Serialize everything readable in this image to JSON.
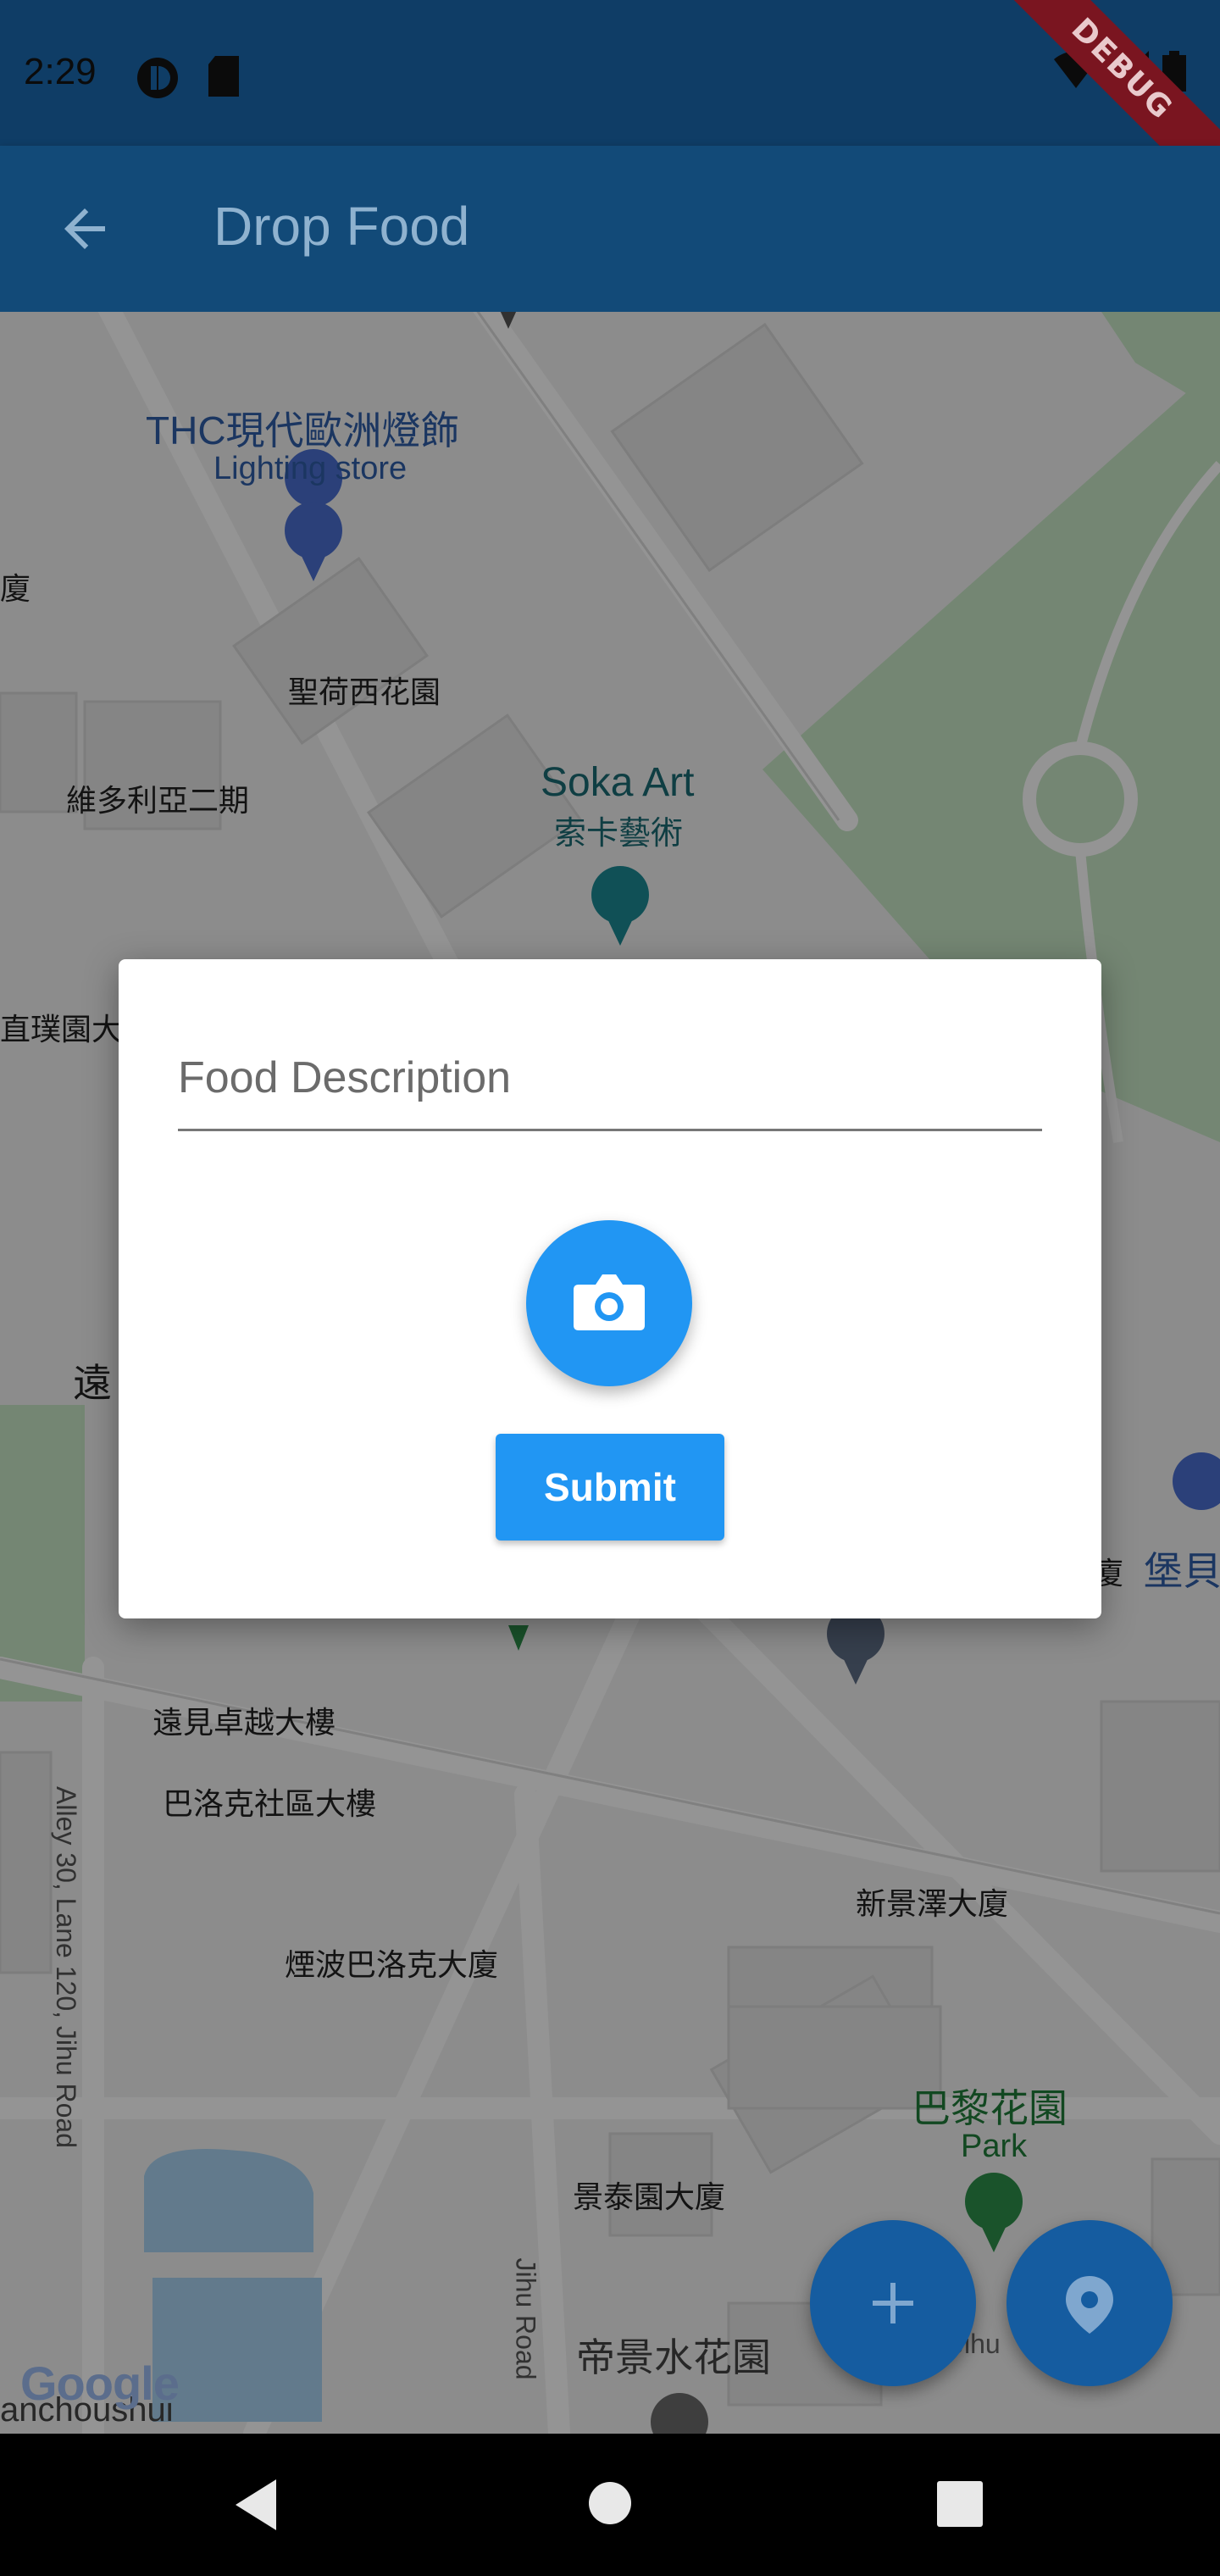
{
  "status_bar": {
    "time": "2:29"
  },
  "app_bar": {
    "title": "Drop Food"
  },
  "debug_banner": "DEBUG",
  "map": {
    "labels": {
      "thc_cn": "THC現代歐洲燈飾",
      "thc_en": "Lighting store",
      "edge_left_1": "廈",
      "holland_garden": "聖荷西花園",
      "victoria": "維多利亞二期",
      "soka_en": "Soka Art",
      "soka_cn": "索卡藝術",
      "edge_left_2": "直璞園大",
      "edge_left_3": "遠",
      "edge_right_1": "廈",
      "edge_right_2": "堡貝",
      "far_east": "遠見卓越大樓",
      "baroque": "巴洛克社區大樓",
      "alley": "Alley 30, Lane 120, Jihu Road",
      "xinjingze": "新景澤大廈",
      "yanbo": "煙波巴洛克大廈",
      "paris_cn": "巴黎花園",
      "paris_en": "Park",
      "jingtai": "景泰園大廈",
      "jihu_road": "Jihu Road",
      "dijing": "帝景水花園",
      "jihu_partial": "Jihu",
      "bottom_edge": "anchoushui"
    },
    "google_logo": "Google"
  },
  "dialog": {
    "description_placeholder": "Food Description",
    "submit_label": "Submit"
  },
  "colors": {
    "app_bar": "#124a78",
    "primary": "#2196f3",
    "fab": "#155ca0"
  }
}
